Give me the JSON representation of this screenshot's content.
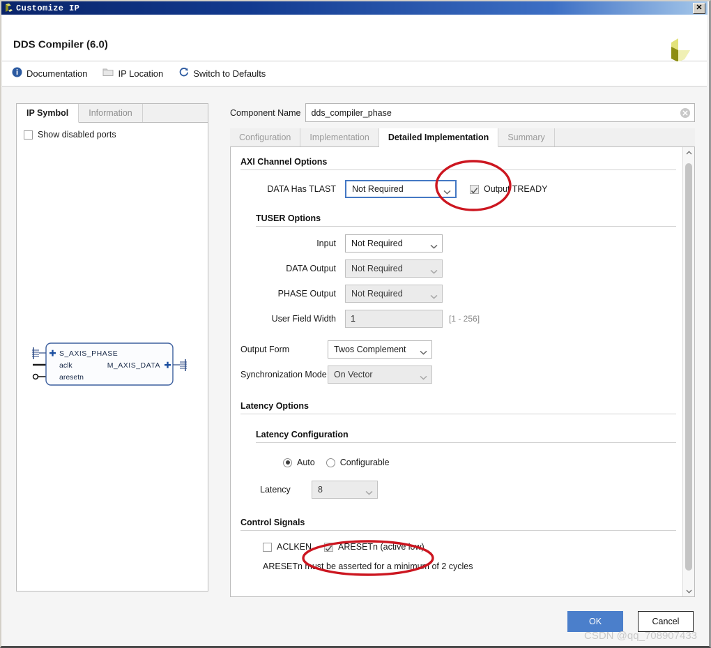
{
  "window": {
    "title": "Customize IP",
    "icon": "xilinx-logo-icon",
    "close_label": "✕"
  },
  "header": {
    "title": "DDS Compiler (6.0)",
    "logo": "xilinx-logo"
  },
  "toolbar": {
    "items": [
      {
        "label": "Documentation",
        "icon": "info-icon"
      },
      {
        "label": "IP Location",
        "icon": "folder-icon"
      },
      {
        "label": "Switch to Defaults",
        "icon": "refresh-icon"
      }
    ]
  },
  "left_panel": {
    "tabs": [
      {
        "label": "IP Symbol",
        "active": true
      },
      {
        "label": "Information",
        "active": false
      }
    ],
    "show_disabled_ports": {
      "label": "Show disabled ports",
      "checked": false
    },
    "symbol": {
      "left_ports": [
        "S_AXIS_PHASE",
        "aclk",
        "aresetn"
      ],
      "right_ports": [
        "M_AXIS_DATA"
      ]
    }
  },
  "component_name": {
    "label": "Component Name",
    "value": "dds_compiler_phase",
    "clear_icon": "clear-circle-icon"
  },
  "tabs": [
    {
      "label": "Configuration",
      "active": false
    },
    {
      "label": "Implementation",
      "active": false
    },
    {
      "label": "Detailed Implementation",
      "active": true
    },
    {
      "label": "Summary",
      "active": false
    }
  ],
  "axi_channel_options": {
    "heading": "AXI Channel Options",
    "data_has_tlast": {
      "label": "DATA Has TLAST",
      "value": "Not Required",
      "enabled": true,
      "focused": true
    },
    "output_tready": {
      "label": "Output TREADY",
      "checked": true,
      "enabled": false
    }
  },
  "tuser_options": {
    "heading": "TUSER Options",
    "input": {
      "label": "Input",
      "value": "Not Required",
      "enabled": true
    },
    "data_output": {
      "label": "DATA Output",
      "value": "Not Required",
      "enabled": false
    },
    "phase_output": {
      "label": "PHASE Output",
      "value": "Not Required",
      "enabled": false
    },
    "user_field_width": {
      "label": "User Field Width",
      "value": "1",
      "range_hint": "[1 - 256]",
      "enabled": false
    }
  },
  "output_form": {
    "label": "Output Form",
    "value": "Twos Complement",
    "enabled": true
  },
  "synchronization_mode": {
    "label": "Synchronization Mode",
    "value": "On Vector",
    "enabled": false
  },
  "latency_options": {
    "heading": "Latency Options",
    "sub_heading": "Latency Configuration",
    "radios": [
      {
        "label": "Auto",
        "selected": true
      },
      {
        "label": "Configurable",
        "selected": false
      }
    ],
    "latency": {
      "label": "Latency",
      "value": "8",
      "enabled": false
    }
  },
  "control_signals": {
    "heading": "Control Signals",
    "aclken": {
      "label": "ACLKEN",
      "checked": false,
      "enabled": true
    },
    "aresetn": {
      "label": "ARESETn (active low)",
      "checked": true,
      "enabled": false
    },
    "note": "ARESETn must be asserted for a minimum of 2 cycles"
  },
  "footer": {
    "ok_label": "OK",
    "cancel_label": "Cancel"
  },
  "watermark": "CSDN @qq_708907433",
  "colors": {
    "titlebar_start": "#0a246a",
    "titlebar_end": "#a6c8ea",
    "accent_blue": "#4b7fcb",
    "focus_blue": "#4478c4",
    "annotation_red": "#cc1620",
    "link_blue": "#2c5aa0"
  }
}
